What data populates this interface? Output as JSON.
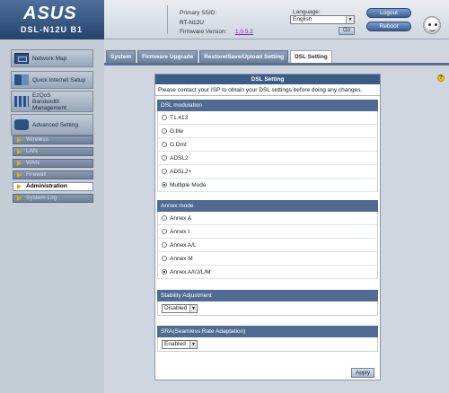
{
  "header": {
    "brand": "ASUS",
    "model": "DSL-N12U B1",
    "ssid_label": "Primary SSID:",
    "ssid_value": "RT-N12U",
    "firmware_label": "Firmware Version:",
    "firmware_value": "1.0.5.2",
    "language_label": "Language:",
    "language_value": "English",
    "go_label": "Go",
    "logout_label": "Logout",
    "reboot_label": "Reboot"
  },
  "sidebar": {
    "main_items": [
      {
        "label": "Network Map",
        "icon": "network-map-icon"
      },
      {
        "label": "Quick Internet Setup",
        "icon": "quick-setup-icon"
      },
      {
        "label": "EzQoS",
        "label2": "Bandwidth",
        "label3": "Management",
        "icon": "ezqos-icon"
      },
      {
        "label": "Advanced Setting",
        "icon": "advanced-setting-icon"
      }
    ],
    "sub_items": [
      {
        "label": "Wireless"
      },
      {
        "label": "LAN"
      },
      {
        "label": "WAN"
      },
      {
        "label": "Firewall"
      },
      {
        "label": "Administration",
        "active": true
      },
      {
        "label": "System Log"
      }
    ]
  },
  "tabs": [
    {
      "label": "System"
    },
    {
      "label": "Firmware Upgrade"
    },
    {
      "label": "Restore/Save/Upload Setting"
    },
    {
      "label": "DSL Setting",
      "active": true
    }
  ],
  "panel": {
    "title": "DSL Setting",
    "note": "Please contact your ISP to obtain your DSL settings before doing any changes.",
    "modulation": {
      "heading": "DSL modulation",
      "options": [
        "T1.413",
        "G.lite",
        "G.Dmt",
        "ADSL2",
        "ADSL2+",
        "Multiple Mode"
      ],
      "selected": "Multiple Mode"
    },
    "annex": {
      "heading": "Annex mode",
      "options": [
        "Annex A",
        "Annex I",
        "Annex A/L",
        "Annex M",
        "Annex A/I/J/L/M"
      ],
      "selected": "Annex A/I/J/L/M"
    },
    "stability": {
      "heading": "Stability Adjustment",
      "value": "Disabled"
    },
    "sra": {
      "heading": "SRA(Seamless Rate Adaptation)",
      "value": "Enabled"
    },
    "apply_label": "Apply"
  },
  "help": "?",
  "colors": {
    "header_dark": "#27446f",
    "panel_title": "#3c5b87",
    "section_head": "#4f6b92"
  }
}
